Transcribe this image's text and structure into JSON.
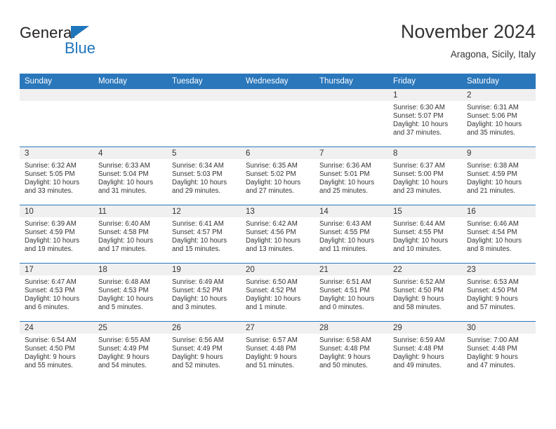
{
  "brand": {
    "name_dark": "General",
    "name_light": "Blue",
    "triangle_color": "#1f76bc"
  },
  "header": {
    "title": "November 2024",
    "subtitle": "Aragona, Sicily, Italy"
  },
  "theme": {
    "header_blue": "#2a77bb",
    "daynum_band": "#f0f0f0",
    "text": "#333333"
  },
  "weekday_headers": [
    "Sunday",
    "Monday",
    "Tuesday",
    "Wednesday",
    "Thursday",
    "Friday",
    "Saturday"
  ],
  "weeks": [
    [
      {
        "day": "",
        "sunrise": "",
        "sunset": "",
        "daylight_line1": "",
        "daylight_line2": ""
      },
      {
        "day": "",
        "sunrise": "",
        "sunset": "",
        "daylight_line1": "",
        "daylight_line2": ""
      },
      {
        "day": "",
        "sunrise": "",
        "sunset": "",
        "daylight_line1": "",
        "daylight_line2": ""
      },
      {
        "day": "",
        "sunrise": "",
        "sunset": "",
        "daylight_line1": "",
        "daylight_line2": ""
      },
      {
        "day": "",
        "sunrise": "",
        "sunset": "",
        "daylight_line1": "",
        "daylight_line2": ""
      },
      {
        "day": "1",
        "sunrise": "Sunrise: 6:30 AM",
        "sunset": "Sunset: 5:07 PM",
        "daylight_line1": "Daylight: 10 hours",
        "daylight_line2": "and 37 minutes."
      },
      {
        "day": "2",
        "sunrise": "Sunrise: 6:31 AM",
        "sunset": "Sunset: 5:06 PM",
        "daylight_line1": "Daylight: 10 hours",
        "daylight_line2": "and 35 minutes."
      }
    ],
    [
      {
        "day": "3",
        "sunrise": "Sunrise: 6:32 AM",
        "sunset": "Sunset: 5:05 PM",
        "daylight_line1": "Daylight: 10 hours",
        "daylight_line2": "and 33 minutes."
      },
      {
        "day": "4",
        "sunrise": "Sunrise: 6:33 AM",
        "sunset": "Sunset: 5:04 PM",
        "daylight_line1": "Daylight: 10 hours",
        "daylight_line2": "and 31 minutes."
      },
      {
        "day": "5",
        "sunrise": "Sunrise: 6:34 AM",
        "sunset": "Sunset: 5:03 PM",
        "daylight_line1": "Daylight: 10 hours",
        "daylight_line2": "and 29 minutes."
      },
      {
        "day": "6",
        "sunrise": "Sunrise: 6:35 AM",
        "sunset": "Sunset: 5:02 PM",
        "daylight_line1": "Daylight: 10 hours",
        "daylight_line2": "and 27 minutes."
      },
      {
        "day": "7",
        "sunrise": "Sunrise: 6:36 AM",
        "sunset": "Sunset: 5:01 PM",
        "daylight_line1": "Daylight: 10 hours",
        "daylight_line2": "and 25 minutes."
      },
      {
        "day": "8",
        "sunrise": "Sunrise: 6:37 AM",
        "sunset": "Sunset: 5:00 PM",
        "daylight_line1": "Daylight: 10 hours",
        "daylight_line2": "and 23 minutes."
      },
      {
        "day": "9",
        "sunrise": "Sunrise: 6:38 AM",
        "sunset": "Sunset: 4:59 PM",
        "daylight_line1": "Daylight: 10 hours",
        "daylight_line2": "and 21 minutes."
      }
    ],
    [
      {
        "day": "10",
        "sunrise": "Sunrise: 6:39 AM",
        "sunset": "Sunset: 4:59 PM",
        "daylight_line1": "Daylight: 10 hours",
        "daylight_line2": "and 19 minutes."
      },
      {
        "day": "11",
        "sunrise": "Sunrise: 6:40 AM",
        "sunset": "Sunset: 4:58 PM",
        "daylight_line1": "Daylight: 10 hours",
        "daylight_line2": "and 17 minutes."
      },
      {
        "day": "12",
        "sunrise": "Sunrise: 6:41 AM",
        "sunset": "Sunset: 4:57 PM",
        "daylight_line1": "Daylight: 10 hours",
        "daylight_line2": "and 15 minutes."
      },
      {
        "day": "13",
        "sunrise": "Sunrise: 6:42 AM",
        "sunset": "Sunset: 4:56 PM",
        "daylight_line1": "Daylight: 10 hours",
        "daylight_line2": "and 13 minutes."
      },
      {
        "day": "14",
        "sunrise": "Sunrise: 6:43 AM",
        "sunset": "Sunset: 4:55 PM",
        "daylight_line1": "Daylight: 10 hours",
        "daylight_line2": "and 11 minutes."
      },
      {
        "day": "15",
        "sunrise": "Sunrise: 6:44 AM",
        "sunset": "Sunset: 4:55 PM",
        "daylight_line1": "Daylight: 10 hours",
        "daylight_line2": "and 10 minutes."
      },
      {
        "day": "16",
        "sunrise": "Sunrise: 6:46 AM",
        "sunset": "Sunset: 4:54 PM",
        "daylight_line1": "Daylight: 10 hours",
        "daylight_line2": "and 8 minutes."
      }
    ],
    [
      {
        "day": "17",
        "sunrise": "Sunrise: 6:47 AM",
        "sunset": "Sunset: 4:53 PM",
        "daylight_line1": "Daylight: 10 hours",
        "daylight_line2": "and 6 minutes."
      },
      {
        "day": "18",
        "sunrise": "Sunrise: 6:48 AM",
        "sunset": "Sunset: 4:53 PM",
        "daylight_line1": "Daylight: 10 hours",
        "daylight_line2": "and 5 minutes."
      },
      {
        "day": "19",
        "sunrise": "Sunrise: 6:49 AM",
        "sunset": "Sunset: 4:52 PM",
        "daylight_line1": "Daylight: 10 hours",
        "daylight_line2": "and 3 minutes."
      },
      {
        "day": "20",
        "sunrise": "Sunrise: 6:50 AM",
        "sunset": "Sunset: 4:52 PM",
        "daylight_line1": "Daylight: 10 hours",
        "daylight_line2": "and 1 minute."
      },
      {
        "day": "21",
        "sunrise": "Sunrise: 6:51 AM",
        "sunset": "Sunset: 4:51 PM",
        "daylight_line1": "Daylight: 10 hours",
        "daylight_line2": "and 0 minutes."
      },
      {
        "day": "22",
        "sunrise": "Sunrise: 6:52 AM",
        "sunset": "Sunset: 4:50 PM",
        "daylight_line1": "Daylight: 9 hours",
        "daylight_line2": "and 58 minutes."
      },
      {
        "day": "23",
        "sunrise": "Sunrise: 6:53 AM",
        "sunset": "Sunset: 4:50 PM",
        "daylight_line1": "Daylight: 9 hours",
        "daylight_line2": "and 57 minutes."
      }
    ],
    [
      {
        "day": "24",
        "sunrise": "Sunrise: 6:54 AM",
        "sunset": "Sunset: 4:50 PM",
        "daylight_line1": "Daylight: 9 hours",
        "daylight_line2": "and 55 minutes."
      },
      {
        "day": "25",
        "sunrise": "Sunrise: 6:55 AM",
        "sunset": "Sunset: 4:49 PM",
        "daylight_line1": "Daylight: 9 hours",
        "daylight_line2": "and 54 minutes."
      },
      {
        "day": "26",
        "sunrise": "Sunrise: 6:56 AM",
        "sunset": "Sunset: 4:49 PM",
        "daylight_line1": "Daylight: 9 hours",
        "daylight_line2": "and 52 minutes."
      },
      {
        "day": "27",
        "sunrise": "Sunrise: 6:57 AM",
        "sunset": "Sunset: 4:48 PM",
        "daylight_line1": "Daylight: 9 hours",
        "daylight_line2": "and 51 minutes."
      },
      {
        "day": "28",
        "sunrise": "Sunrise: 6:58 AM",
        "sunset": "Sunset: 4:48 PM",
        "daylight_line1": "Daylight: 9 hours",
        "daylight_line2": "and 50 minutes."
      },
      {
        "day": "29",
        "sunrise": "Sunrise: 6:59 AM",
        "sunset": "Sunset: 4:48 PM",
        "daylight_line1": "Daylight: 9 hours",
        "daylight_line2": "and 49 minutes."
      },
      {
        "day": "30",
        "sunrise": "Sunrise: 7:00 AM",
        "sunset": "Sunset: 4:48 PM",
        "daylight_line1": "Daylight: 9 hours",
        "daylight_line2": "and 47 minutes."
      }
    ]
  ]
}
